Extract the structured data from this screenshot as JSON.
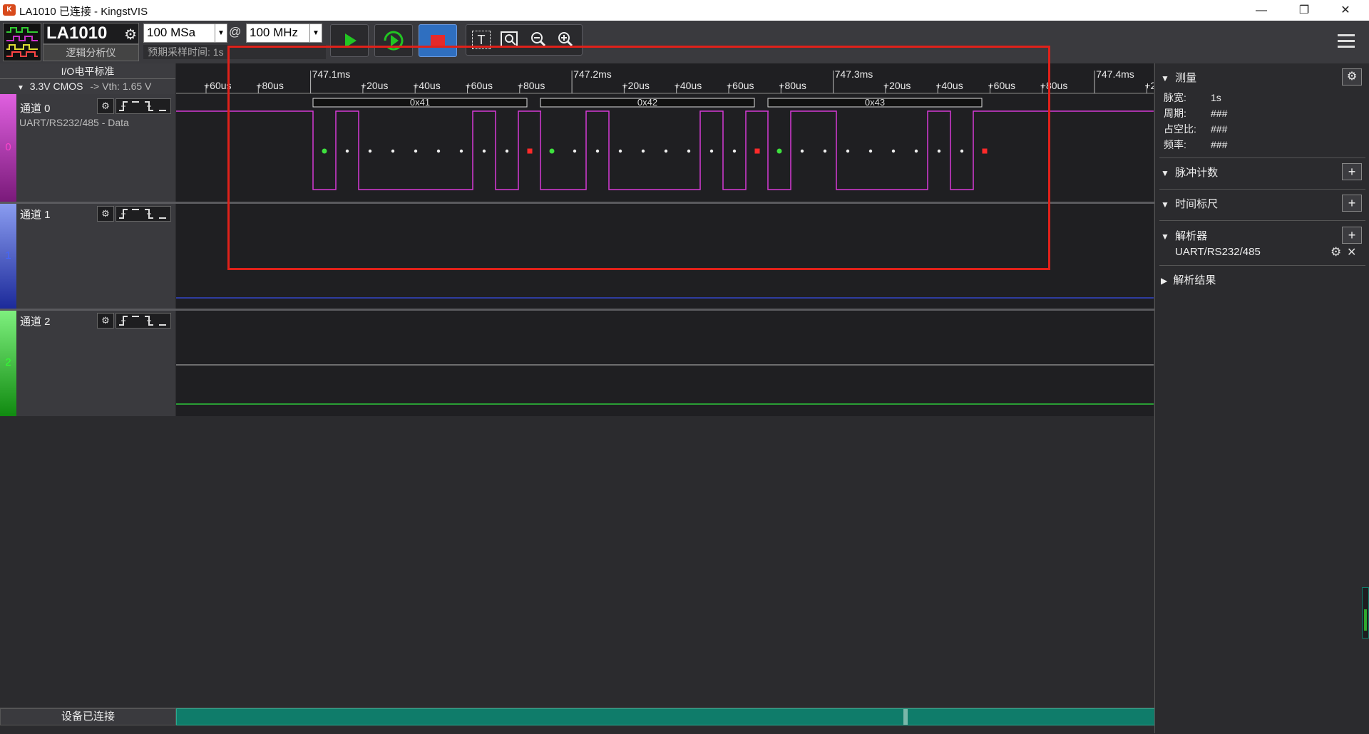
{
  "window": {
    "app_icon": "kingst-logo-icon",
    "title": "LA1010 已连接 - KingstVIS",
    "controls": {
      "minimize": "—",
      "restore": "❐",
      "close": "✕"
    }
  },
  "toolbar": {
    "device_name": "LA1010",
    "device_subtitle": "逻辑分析仪",
    "sample_depth": "100 MSa",
    "at_symbol": "@",
    "sample_rate": "100 MHz",
    "expected_time_label": "预期采样时间: 1s"
  },
  "io_panel": {
    "header": "I/O电平标准",
    "level": "3.3V CMOS",
    "vth": "-> Vth: 1.65 V"
  },
  "channels": [
    {
      "index": "0",
      "name": "通道 0",
      "decoder": "UART/RS232/485 - Data",
      "color": "#d63ad6"
    },
    {
      "index": "1",
      "name": "通道 1",
      "color": "#3347c9"
    },
    {
      "index": "2",
      "name": "通道 2",
      "color": "#2fc93a"
    }
  ],
  "ruler": {
    "labels": [
      "+60us",
      "+80us",
      "747.1ms",
      "+20us",
      "+40us",
      "+60us",
      "+80us",
      "747.2ms",
      "+20us",
      "+40us",
      "+60us",
      "+80us",
      "747.3ms",
      "+20us",
      "+40us",
      "+60us",
      "+80us",
      "747.4ms",
      "+2"
    ]
  },
  "decoded": {
    "bytes": [
      "0x41",
      "0x42",
      "0x43"
    ],
    "bits": [
      [
        1,
        0,
        0,
        0,
        0,
        0,
        1,
        0
      ],
      [
        0,
        1,
        0,
        0,
        0,
        0,
        1,
        0
      ],
      [
        1,
        1,
        0,
        0,
        0,
        0,
        1,
        0
      ]
    ]
  },
  "status": {
    "device_status": "设备已连接"
  },
  "right_panel": {
    "measure_title": "测量",
    "measure": [
      {
        "label": "脉宽:",
        "value": "1s"
      },
      {
        "label": "周期:",
        "value": "###"
      },
      {
        "label": "占空比:",
        "value": "###"
      },
      {
        "label": "频率:",
        "value": "###"
      }
    ],
    "pulse_count": "脉冲计数",
    "time_ruler": "时间标尺",
    "analyzer": "解析器",
    "analyzer_item": "UART/RS232/485",
    "results": "解析结果"
  },
  "colors": {
    "highlight_box": "#e0211a",
    "channel0": "#d63ad6",
    "channel1": "#3347c9",
    "channel2": "#2fc93a",
    "start_bit": "#3ee03e",
    "stop_bit": "#ff2a2a",
    "scrollbar": "#0f7c6a"
  }
}
